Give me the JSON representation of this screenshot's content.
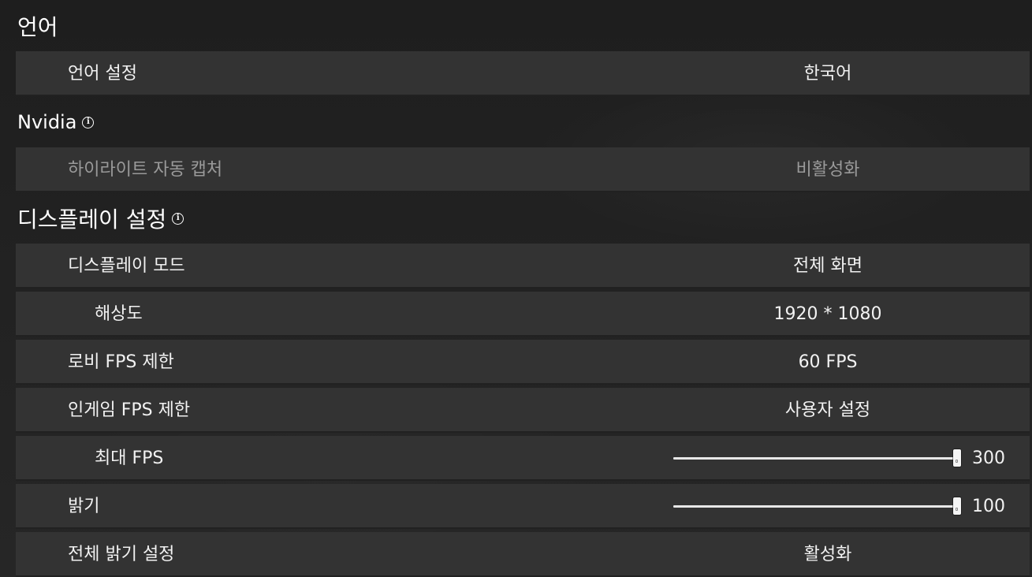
{
  "sections": {
    "language": {
      "title": "언어",
      "rows": {
        "language_setting": {
          "label": "언어 설정",
          "value": "한국어"
        }
      }
    },
    "nvidia": {
      "title": "Nvidia",
      "info_icon": "info-icon",
      "rows": {
        "highlight_auto_capture": {
          "label": "하이라이트 자동 캡처",
          "value": "비활성화"
        }
      }
    },
    "display": {
      "title": "디스플레이 설정",
      "info_icon": "info-icon",
      "rows": {
        "display_mode": {
          "label": "디스플레이 모드",
          "value": "전체 화면"
        },
        "resolution": {
          "label": "해상도",
          "value": "1920 * 1080"
        },
        "lobby_fps_limit": {
          "label": "로비 FPS 제한",
          "value": "60 FPS"
        },
        "ingame_fps_limit": {
          "label": "인게임 FPS 제한",
          "value": "사용자 설정"
        },
        "max_fps": {
          "label": "최대 FPS",
          "value": "300",
          "slider_fraction": 1.0
        },
        "brightness": {
          "label": "밝기",
          "value": "100",
          "slider_fraction": 1.0
        },
        "global_brightness": {
          "label": "전체 밝기 설정",
          "value": "활성화"
        }
      }
    }
  },
  "colors": {
    "background": "#232323",
    "row_background": "#333333",
    "text": "#f2f2f2",
    "disabled_text": "#9a9a9a"
  }
}
